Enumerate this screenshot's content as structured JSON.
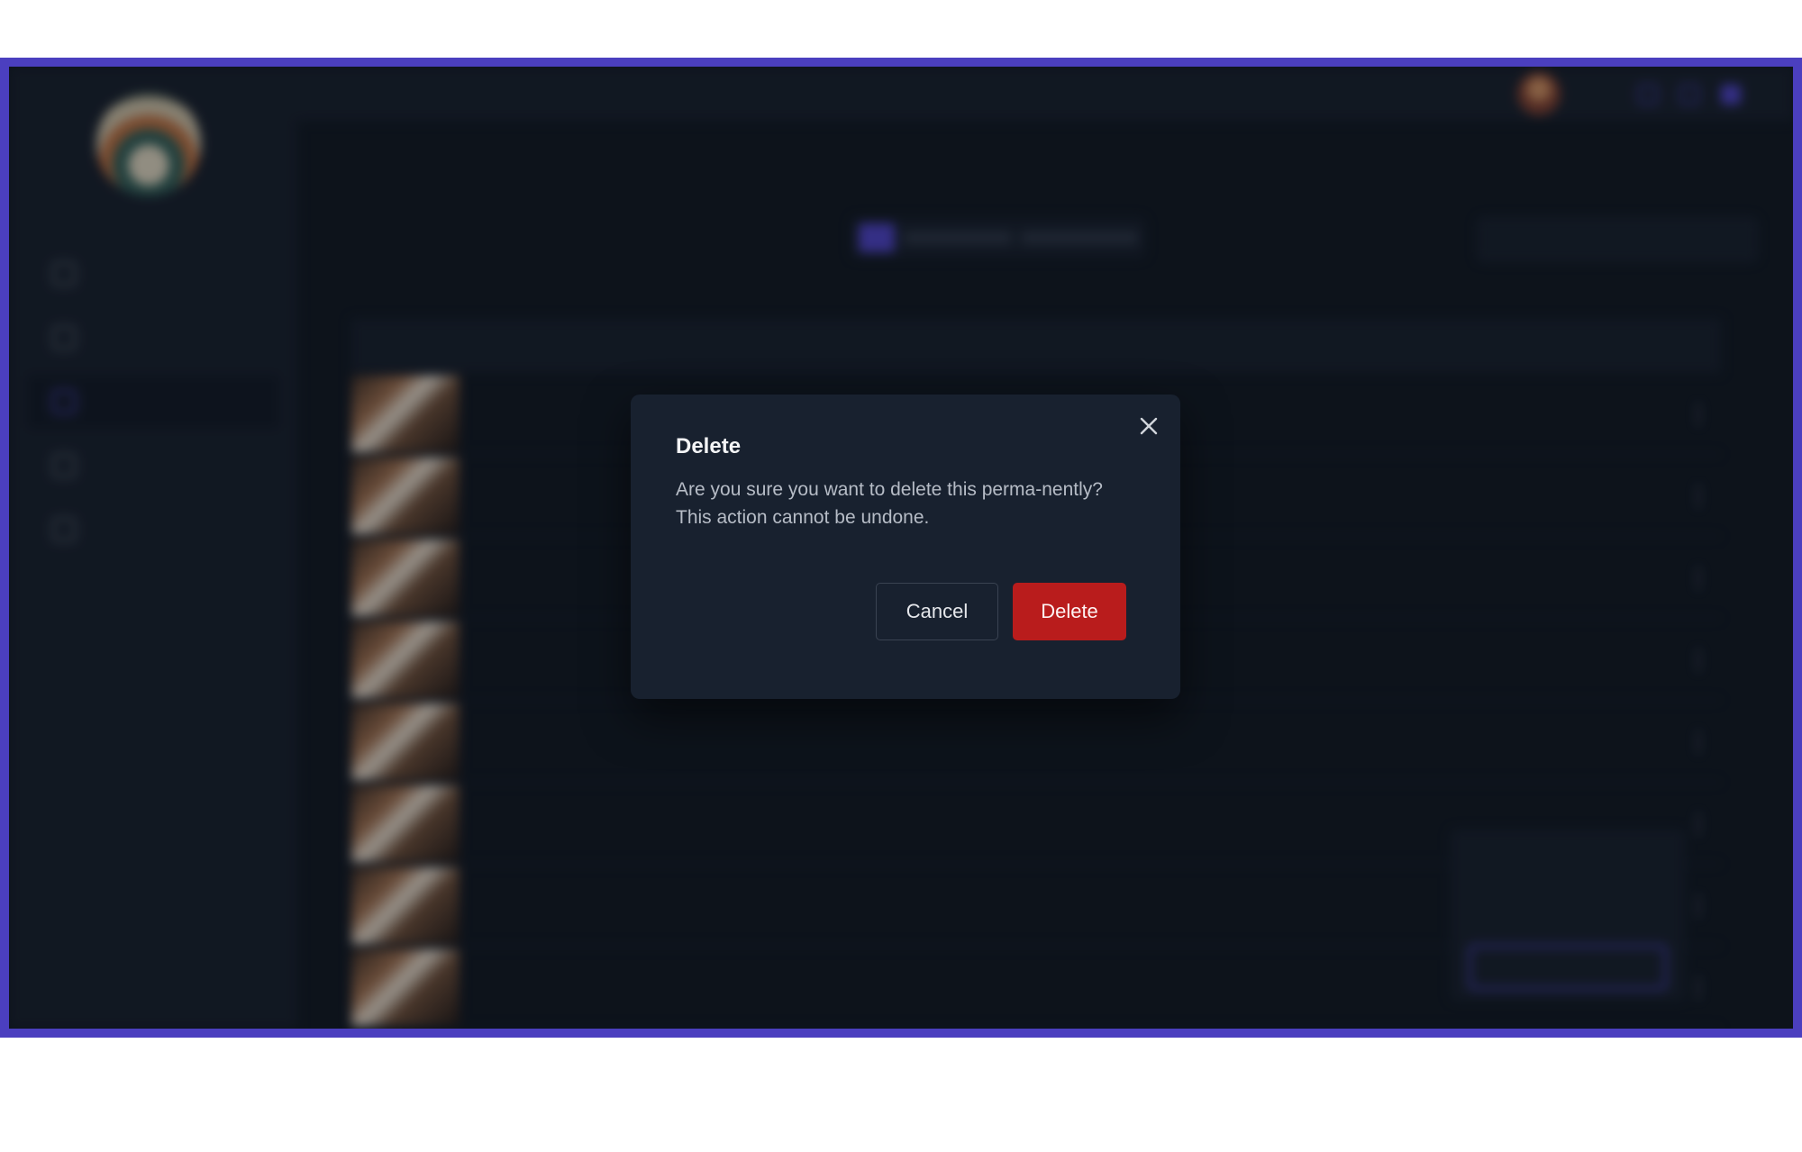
{
  "modal": {
    "title": "Delete",
    "message": "Are you sure you want to delete this perma-nently? This action cannot be undone.",
    "cancel_label": "Cancel",
    "delete_label": "Delete",
    "close_icon": "close-icon"
  },
  "colors": {
    "accent": "#4b3fbf",
    "danger": "#b91c1c",
    "background": "#0e141d",
    "modal": "#18212f"
  }
}
